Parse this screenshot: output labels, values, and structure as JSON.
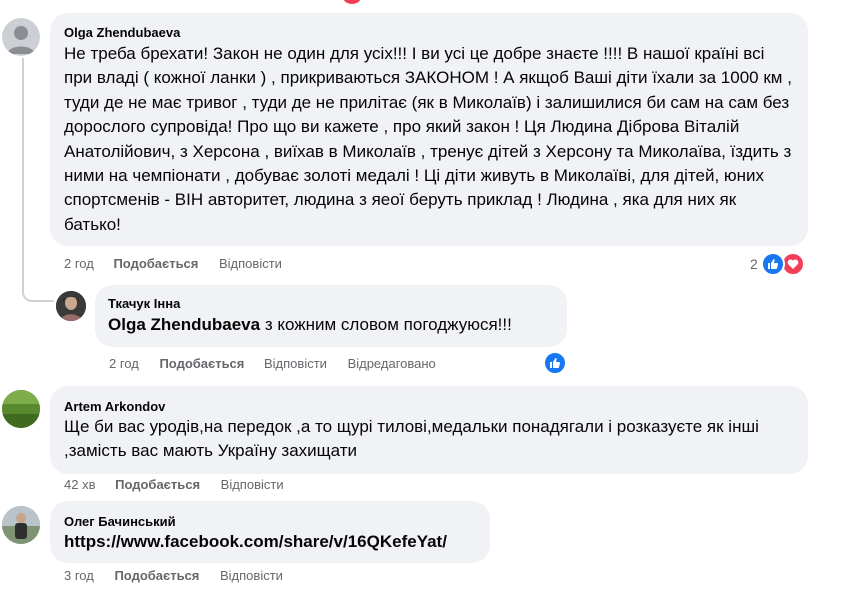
{
  "comments": [
    {
      "author": "Olga Zhendubaeva",
      "text": "Не треба брехати! Закон не один для усіх!!! І ви усі це добре знаєте !!!! В нашої країні всі при владі ( кожної ланки ) , прикриваються ЗАКОНОМ ! А якщоб Ваші діти їхали за 1000 км , туди де не має тривог , туди де не прилітає (як в Миколаїв) і залишилися би сам на сам без дорослого супровіда! Про що ви кажете , про який закон ! Ця Людина Діброва Віталій Анатолійович, з Херсона , виїхав в Миколаїв , тренує дітей з Херсону та Миколаїва, їздить з ними на чемпіонати , добуває золоті медалі ! Ці діти живуть в Миколаїві, для дітей, юних спортсменів - ВІН авторитет, людина з яеої беруть приклад ! Людина , яка для них як батько!",
      "time": "2 год",
      "like": "Подобається",
      "reply": "Відповісти",
      "reactions_count": "2"
    },
    {
      "author": "Ткачук Інна",
      "mention": "Olga Zhendubaeva",
      "text": " з кожним словом погоджуюся!!!",
      "time": "2 год",
      "like": "Подобається",
      "reply": "Відповісти",
      "edited": "Відредаговано"
    },
    {
      "author": "Artem Arkondov",
      "text": "Ще би вас уродів,на передок ,а то щурі тилові,медальки понадягали і розказуєте як інші ,замість вас мають Україну захищати",
      "time": "42 хв",
      "like": "Подобається",
      "reply": "Відповісти"
    },
    {
      "author": "Олег Бачинський",
      "text": "https://www.facebook.com/share/v/16QKefeYat/",
      "time": "3 год",
      "like": "Подобається",
      "reply": "Відповісти"
    }
  ],
  "colors": {
    "bubble": "#f0f2f5",
    "meta": "#65676b",
    "like_blue": "#1877f2",
    "love_red": "#f33e58"
  },
  "icons": [
    "user-default-icon",
    "like-icon",
    "love-icon"
  ]
}
